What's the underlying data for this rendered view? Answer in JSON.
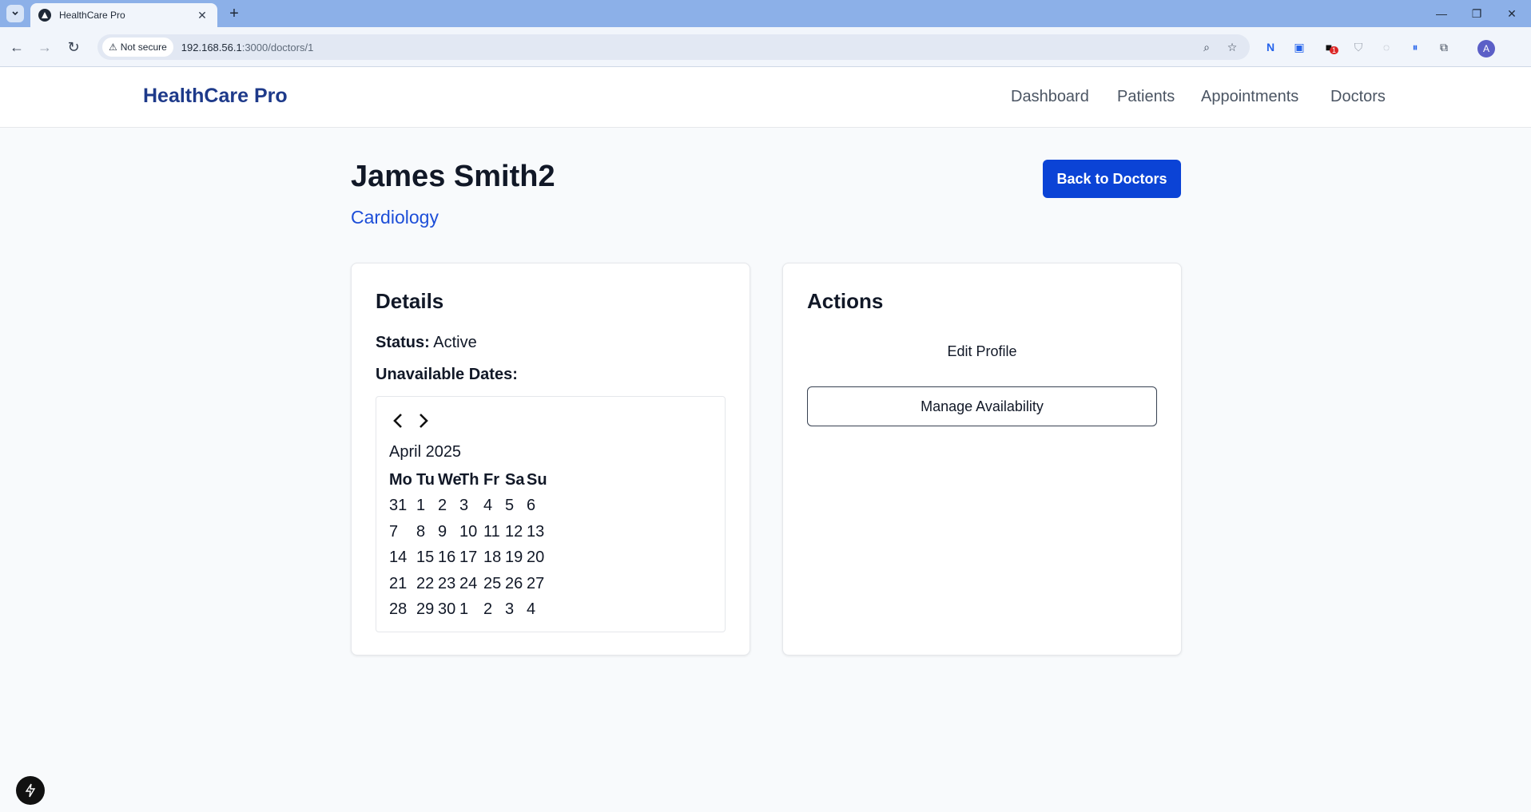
{
  "browser": {
    "tab_title": "HealthCare Pro",
    "security_label": "Not secure",
    "url_host": "192.168.56.1",
    "url_path": ":3000/doctors/1",
    "profile_initial": "A",
    "extension_badge": "1"
  },
  "header": {
    "brand": "HealthCare Pro",
    "nav": [
      "Dashboard",
      "Patients",
      "Appointments",
      "Doctors"
    ]
  },
  "doctor": {
    "name": "James Smith2",
    "specialty": "Cardiology",
    "back_label": "Back to Doctors"
  },
  "details": {
    "title": "Details",
    "status_label": "Status:",
    "status_value": "Active",
    "unavailable_label": "Unavailable Dates:"
  },
  "calendar": {
    "month": "April 2025",
    "weekdays": [
      "Mo",
      "Tu",
      "We",
      "Th",
      "Fr",
      "Sa",
      "Su"
    ],
    "weeks": [
      [
        "31",
        "1",
        "2",
        "3",
        "4",
        "5",
        "6"
      ],
      [
        "7",
        "8",
        "9",
        "10",
        "11",
        "12",
        "13"
      ],
      [
        "14",
        "15",
        "16",
        "17",
        "18",
        "19",
        "20"
      ],
      [
        "21",
        "22",
        "23",
        "24",
        "25",
        "26",
        "27"
      ],
      [
        "28",
        "29",
        "30",
        "1",
        "2",
        "3",
        "4"
      ]
    ]
  },
  "actions": {
    "title": "Actions",
    "edit_label": "Edit Profile",
    "manage_label": "Manage Availability"
  },
  "colors": {
    "brand": "#1e3a8a",
    "primary_button": "#0b43d6",
    "specialty_link": "#1d4ed8"
  }
}
